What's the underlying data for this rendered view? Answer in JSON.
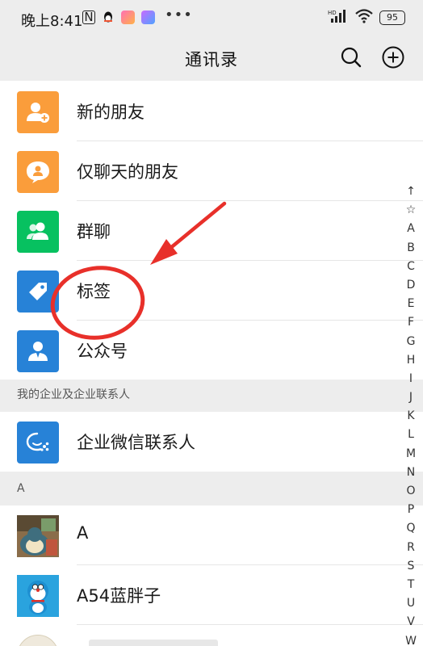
{
  "status_bar": {
    "time": "晚上8:41",
    "battery": "95",
    "network": "HD"
  },
  "header": {
    "title": "通讯录",
    "search_icon": "search-icon",
    "add_icon": "plus-circle-icon"
  },
  "menu_items": [
    {
      "label": "新的朋友",
      "icon": "add-friend-icon",
      "color": "#FA9D3B"
    },
    {
      "label": "仅聊天的朋友",
      "icon": "chat-bubble-user-icon",
      "color": "#FA9D3B"
    },
    {
      "label": "群聊",
      "icon": "group-icon",
      "color": "#07C160"
    },
    {
      "label": "标签",
      "icon": "tag-icon",
      "color": "#2782D7"
    },
    {
      "label": "公众号",
      "icon": "official-account-icon",
      "color": "#2782D7"
    }
  ],
  "enterprise_section": {
    "title": "我的企业及企业联系人",
    "item": {
      "label": "企业微信联系人",
      "icon": "wecom-icon",
      "color": "#2782D7"
    }
  },
  "contacts_section": {
    "letter": "A",
    "contacts": [
      {
        "name": "A"
      },
      {
        "name": "A54蓝胖子"
      }
    ]
  },
  "index_letters": [
    "↑",
    "☆",
    "A",
    "B",
    "C",
    "D",
    "E",
    "F",
    "G",
    "H",
    "I",
    "J",
    "K",
    "L",
    "M",
    "N",
    "O",
    "P",
    "Q",
    "R",
    "S",
    "T",
    "U",
    "V",
    "W"
  ],
  "colors": {
    "orange": "#FA9D3B",
    "green": "#07C160",
    "blue": "#2782D7",
    "annotation_red": "#E8302A"
  }
}
